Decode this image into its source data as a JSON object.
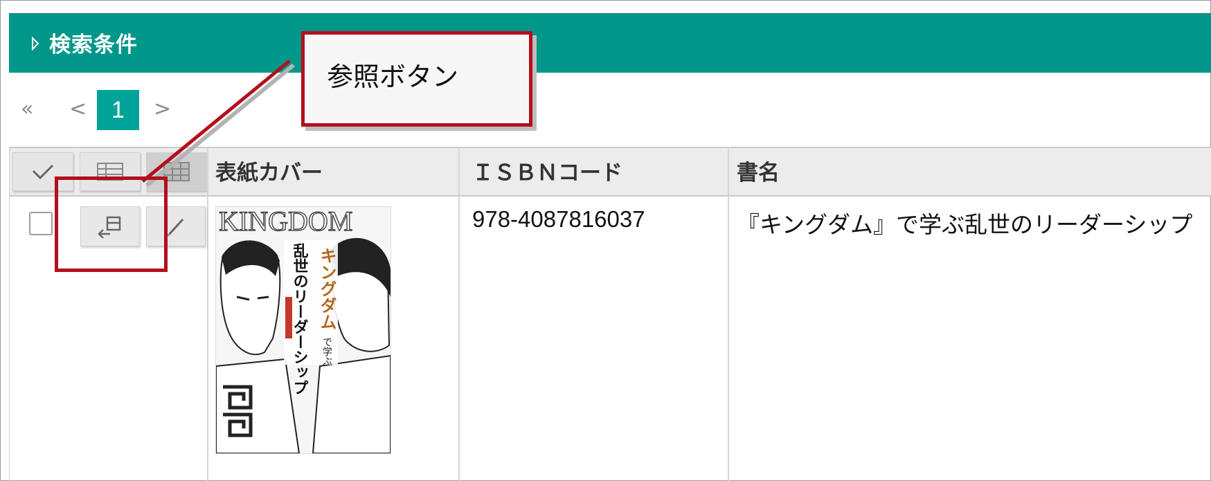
{
  "search": {
    "title": "検索条件"
  },
  "pager": {
    "first": "«",
    "prev": "<",
    "current": "1",
    "next": ">"
  },
  "columns": {
    "cover": "表紙カバー",
    "isbn": "ＩＳＢＮコード",
    "title": "書名"
  },
  "rows": [
    {
      "isbn": "978-4087816037",
      "title": "『キングダム』で学ぶ乱世のリーダーシップ",
      "cover": {
        "series": "KINGDOM",
        "title_vertical": "乱世のリーダーシップ",
        "title_accent": "キングダム",
        "sub": "で学ぶ"
      }
    }
  ],
  "callout": {
    "text": "参照ボタン"
  },
  "colors": {
    "header_teal": "#00968a",
    "page_active": "#00a398",
    "annotation_red": "#b2101c"
  },
  "icons": {
    "header_check": "checkmark-icon",
    "header_grid": "grid-view-icon",
    "header_grid_alt": "grid-alt-icon",
    "row_reference": "reference-icon",
    "row_edit": "pencil-icon"
  }
}
